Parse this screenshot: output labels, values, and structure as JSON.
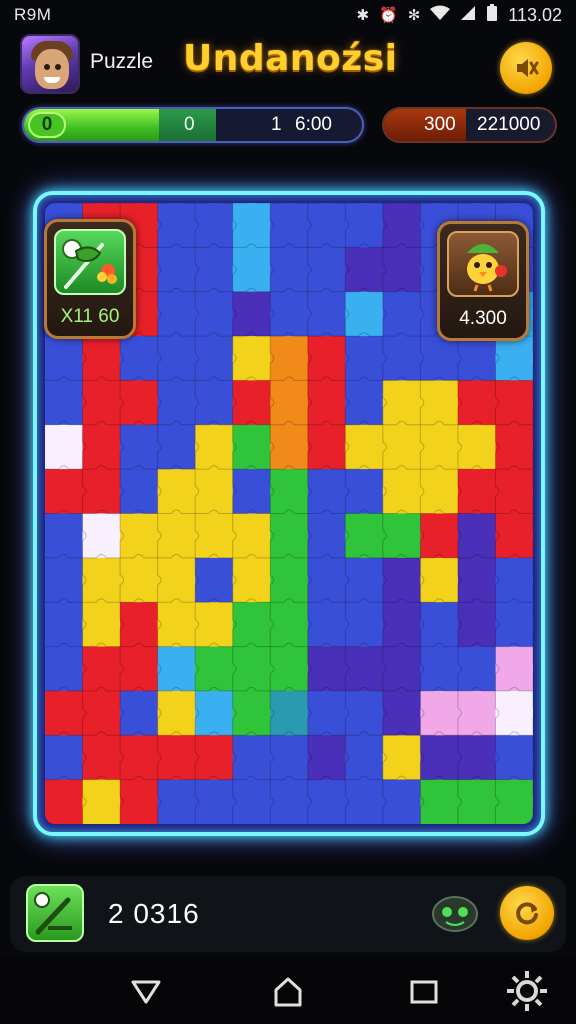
{
  "status_bar": {
    "carrier": "R9M",
    "time": "113.02"
  },
  "header": {
    "subtitle": "Puzzle",
    "title": "Undanoźsi"
  },
  "progress": {
    "knob_label": "0",
    "mid_label": "0",
    "level": "1",
    "timer": "6:00",
    "fill_fraction": 0.4
  },
  "score": {
    "value": "300",
    "target": "221000"
  },
  "bonuses": {
    "left": {
      "label": "X11 60",
      "icon": "flower-wand-icon"
    },
    "right": {
      "label": "4.300",
      "icon": "chick-elf-icon"
    }
  },
  "bottom": {
    "coins": "2 0316",
    "hint_icon": "wand-icon",
    "monster_icon": "monster-icon",
    "refresh_icon": "refresh-icon"
  },
  "colors": {
    "accent": "#ffcf2e",
    "board_glow": "#3ee8ff",
    "progress_green": "#3fbf23"
  }
}
